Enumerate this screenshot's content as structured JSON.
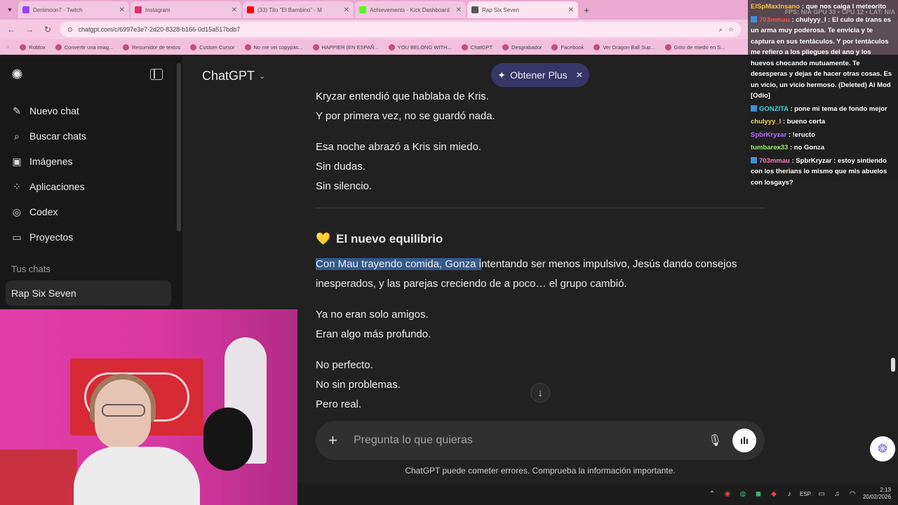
{
  "browser": {
    "tabs": [
      {
        "title": "Denimoon7 - Twitch",
        "color": "#9146ff"
      },
      {
        "title": "Instagram",
        "color": "#e1306c"
      },
      {
        "title": "(33) Tito \"El Bambino\" - M",
        "color": "#ff0000"
      },
      {
        "title": "Achievements - Kick Dashboard",
        "color": "#53fc18"
      },
      {
        "title": "Rap Six Seven",
        "color": "#555555"
      }
    ],
    "url": "chatgpt.com/c/6997e3e7-2d20-8328-b166-0d15a517bdb7",
    "bookmarks": [
      "Roblox",
      "Convertir una imag...",
      "Resumidor de textos",
      "Custom Cursor",
      "No me vei copypas...",
      "HAPPIER (EN ESPAÑ...",
      "YOU BELONG WITH...",
      "ChatGPT",
      "Desgrabador",
      "Facebook",
      "Ver Dragon Ball Sup...",
      "Grito de miedo en S..."
    ]
  },
  "sidebar": {
    "items": [
      {
        "label": "Nuevo chat",
        "icon": "new-chat-icon",
        "glyph": "✎"
      },
      {
        "label": "Buscar chats",
        "icon": "search-icon",
        "glyph": "⌕"
      },
      {
        "label": "Imágenes",
        "icon": "images-icon",
        "glyph": "▣"
      },
      {
        "label": "Aplicaciones",
        "icon": "apps-icon",
        "glyph": "⁘"
      },
      {
        "label": "Codex",
        "icon": "codex-icon",
        "glyph": "◎"
      },
      {
        "label": "Proyectos",
        "icon": "folder-icon",
        "glyph": "▭"
      }
    ],
    "section_label": "Tus chats",
    "active_chat": "Rap Six Seven"
  },
  "header": {
    "model": "ChatGPT",
    "plus_label": "Obtener Plus"
  },
  "content": {
    "p1": [
      "Kryzar entendió que hablaba de Kris.",
      "Y por primera vez, no se guardó nada."
    ],
    "p2": [
      "Esa noche abrazó a Kris sin miedo.",
      "Sin dudas.",
      "Sin silencio."
    ],
    "heading": "El nuevo equilibrio",
    "p3_selected": "Con Mau trayendo comida, Gonza i",
    "p3_rest": "ntentando ser menos impulsivo, Jesús dando consejos inesperados, y las parejas creciendo de a poco… el grupo cambió.",
    "p4": [
      "Ya no eran solo amigos.",
      "Eran algo más profundo."
    ],
    "p5": [
      "No perfecto.",
      "No sin problemas.",
      "Pero real."
    ]
  },
  "composer": {
    "placeholder": "Pregunta lo que quieras"
  },
  "disclaimer": "ChatGPT puede cometer errores. Comprueba la información importante.",
  "stream_chat": {
    "stats": "FPS: N/A   GPU 33 ▪   CPU 12 ▪   LAT: N/A",
    "messages": [
      {
        "user": "ElSpMaxInsano",
        "text": "que nos caiga l meteorito",
        "color": "u-orange",
        "badge": false
      },
      {
        "user": "703mmau",
        "text": "chulyyy_l : El culo de trans es un arma muy poderosa. Te envicia y te captura en sus tentáculos. Y por tentáculos me refiero a los pliegues del ano y los huevos chocando mutuamente. Te desesperas y dejas de hacer otras cosas. Es un vicio, un vicio hermoso. (Deleted) Al Mod [Odio]",
        "color": "u-red",
        "badge": true
      },
      {
        "user": "GONZITA",
        "text": "pone mi tema de fondo mejor",
        "color": "u-cyan",
        "badge": true
      },
      {
        "user": "chulyyy_l",
        "text": "bueno corta",
        "color": "u-yellow",
        "badge": false
      },
      {
        "user": "SpbrKryzar",
        "text": "!eructo",
        "color": "u-purple",
        "badge": false
      },
      {
        "user": "tumbarex33",
        "text": "no Gonza",
        "color": "u-green",
        "badge": false
      },
      {
        "user": "703mmau",
        "text": "SpbrKryzar : estoy sintiendo con los therians lo mismo que mis abuelos con losgays?",
        "color": "u-pink",
        "badge": true
      }
    ]
  },
  "taskbar": {
    "lang": "ESP",
    "time": "2:13",
    "date": "20/02/2026"
  }
}
